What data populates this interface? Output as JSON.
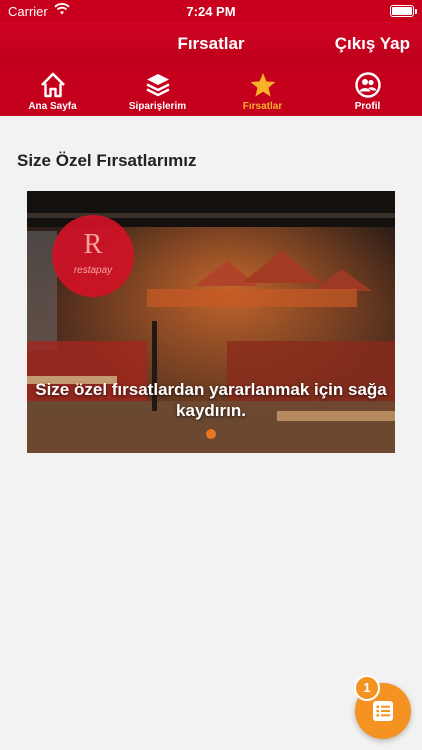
{
  "status_bar": {
    "carrier": "Carrier",
    "time": "7:24 PM"
  },
  "nav": {
    "title": "Fırsatlar",
    "logout_label": "Çıkış Yap"
  },
  "tabs": [
    {
      "label": "Ana Sayfa",
      "icon": "home-icon",
      "active": false
    },
    {
      "label": "Siparişlerim",
      "icon": "layers-icon",
      "active": false
    },
    {
      "label": "Fırsatlar",
      "icon": "star-icon",
      "active": true
    },
    {
      "label": "Profil",
      "icon": "profile-icon",
      "active": false
    }
  ],
  "main": {
    "section_title": "Size Özel Fırsatlarımız",
    "promo": {
      "logo_text": "restapay",
      "caption": "Size özel fırsatlardan yararlanmak için sağa kaydırın.",
      "page_count": 1,
      "current_page": 1
    }
  },
  "fab": {
    "icon": "list-icon",
    "badge_count": "1"
  },
  "colors": {
    "primary_red": "#c8001e",
    "active_tab": "#f7b228",
    "accent_orange": "#f49321",
    "background": "#f2f2f2"
  }
}
